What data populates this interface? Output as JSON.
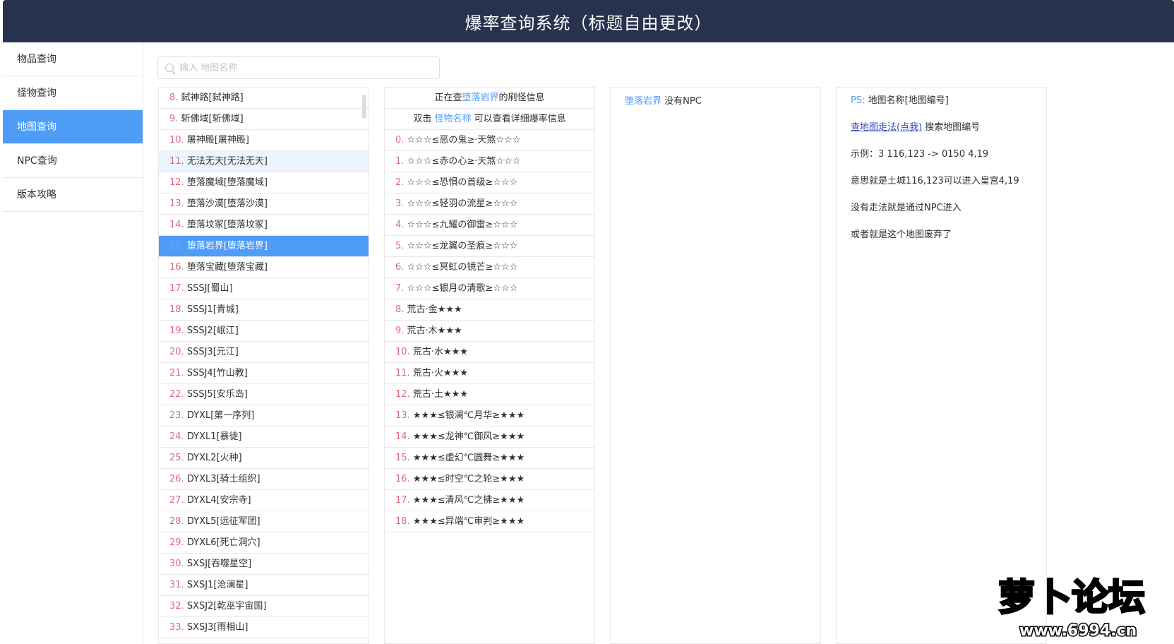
{
  "header": {
    "title": "爆率查询系统（标题自由更改）"
  },
  "sidebar": {
    "items": [
      {
        "label": "物品查询",
        "active": false
      },
      {
        "label": "怪物查询",
        "active": false
      },
      {
        "label": "地图查询",
        "active": true
      },
      {
        "label": "NPC查询",
        "active": false
      },
      {
        "label": "版本攻略",
        "active": false
      }
    ]
  },
  "search": {
    "placeholder": "输入 地图名称",
    "value": ""
  },
  "maps": [
    {
      "num": "8.",
      "name": "弑神路[弑神路]"
    },
    {
      "num": "9.",
      "name": "斩佛域[斩佛域]"
    },
    {
      "num": "10.",
      "name": "屠神殿[屠神殿]"
    },
    {
      "num": "11.",
      "name": "无法无天[无法无天]"
    },
    {
      "num": "12.",
      "name": "堕落魔域[堕落魔域]"
    },
    {
      "num": "13.",
      "name": "堕落沙漠[堕落沙漠]"
    },
    {
      "num": "14.",
      "name": "堕落坟冢[堕落坟冢]"
    },
    {
      "num": "15.",
      "name": "堕落岩界[堕落岩界]"
    },
    {
      "num": "16.",
      "name": "堕落宝藏[堕落宝藏]"
    },
    {
      "num": "17.",
      "name": "SSSJ[蜀山]"
    },
    {
      "num": "18.",
      "name": "SSSJ1[青城]"
    },
    {
      "num": "19.",
      "name": "SSSJ2[岷江]"
    },
    {
      "num": "20.",
      "name": "SSSJ3[元江]"
    },
    {
      "num": "21.",
      "name": "SSSJ4[竹山教]"
    },
    {
      "num": "22.",
      "name": "SSSJ5[安乐岛]"
    },
    {
      "num": "23.",
      "name": "DYXL[第一序列]"
    },
    {
      "num": "24.",
      "name": "DYXL1[暴徒]"
    },
    {
      "num": "25.",
      "name": "DYXL2[火种]"
    },
    {
      "num": "26.",
      "name": "DYXL3[骑士组织]"
    },
    {
      "num": "27.",
      "name": "DYXL4[安宗寺]"
    },
    {
      "num": "28.",
      "name": "DYXL5[远征军团]"
    },
    {
      "num": "29.",
      "name": "DYXL6[死亡洞穴]"
    },
    {
      "num": "30.",
      "name": "SXSJ[吞噬星空]"
    },
    {
      "num": "31.",
      "name": "SXSJ1[沧澜星]"
    },
    {
      "num": "32.",
      "name": "SXSJ2[乾巫宇宙国]"
    },
    {
      "num": "33.",
      "name": "SXSJ3[雨相山]"
    }
  ],
  "monster_panel": {
    "header1_prefix": "正在查",
    "header1_map": "堕落岩界",
    "header1_suffix": "的刷怪信息",
    "header2_prefix": "双击 ",
    "header2_link": "怪物名称",
    "header2_suffix": " 可以查看详细爆率信息",
    "monsters": [
      {
        "num": "0.",
        "name": "☆☆☆≤恶の鬼≥·天煞☆☆☆"
      },
      {
        "num": "1.",
        "name": "☆☆☆≤赤の心≥·天煞☆☆☆"
      },
      {
        "num": "2.",
        "name": "☆☆☆≤恐惧の首级≥☆☆☆"
      },
      {
        "num": "3.",
        "name": "☆☆☆≤轻羽の流星≥☆☆☆"
      },
      {
        "num": "4.",
        "name": "☆☆☆≤九耀の御雷≥☆☆☆"
      },
      {
        "num": "5.",
        "name": "☆☆☆≤龙翼の圣痕≥☆☆☆"
      },
      {
        "num": "6.",
        "name": "☆☆☆≤冥虹の镜芒≥☆☆☆"
      },
      {
        "num": "7.",
        "name": "☆☆☆≤银月の清歌≥☆☆☆"
      },
      {
        "num": "8.",
        "name": "荒古·金★★★"
      },
      {
        "num": "9.",
        "name": "荒古·木★★★"
      },
      {
        "num": "10.",
        "name": "荒古·水★★★"
      },
      {
        "num": "11.",
        "name": "荒古·火★★★"
      },
      {
        "num": "12.",
        "name": "荒古·土★★★"
      },
      {
        "num": "13.",
        "name": "★★★≤银澜℃月华≥★★★"
      },
      {
        "num": "14.",
        "name": "★★★≤龙神℃御风≥★★★"
      },
      {
        "num": "15.",
        "name": "★★★≤虚幻℃圆舞≥★★★"
      },
      {
        "num": "16.",
        "name": "★★★≤时空℃之轮≥★★★"
      },
      {
        "num": "17.",
        "name": "★★★≤清风℃之拂≥★★★"
      },
      {
        "num": "18.",
        "name": "★★★≤异端℃审判≥★★★"
      }
    ]
  },
  "npc_panel": {
    "map": "堕落岩界",
    "text": " 没有NPC"
  },
  "info_panel": {
    "ps_label": "PS:",
    "ps_text": "  地图名称[地图编号]",
    "link_text": "查地图走法(点我)",
    "link_suffix": " 搜索地图编号",
    "example": "示例：3 116,123 -> 0150 4,19",
    "meaning": "意思就是土城116,123可以进入皇宫4,19",
    "no_route": "没有走法就是通过NPC进入",
    "abandoned": "或者就是这个地图废弃了"
  },
  "watermark": {
    "text": "萝卜论坛",
    "url": "www.6994.cn"
  },
  "colors": {
    "header_bg": "#27324d",
    "accent": "#4f9cf7",
    "number": "#e06c75"
  }
}
